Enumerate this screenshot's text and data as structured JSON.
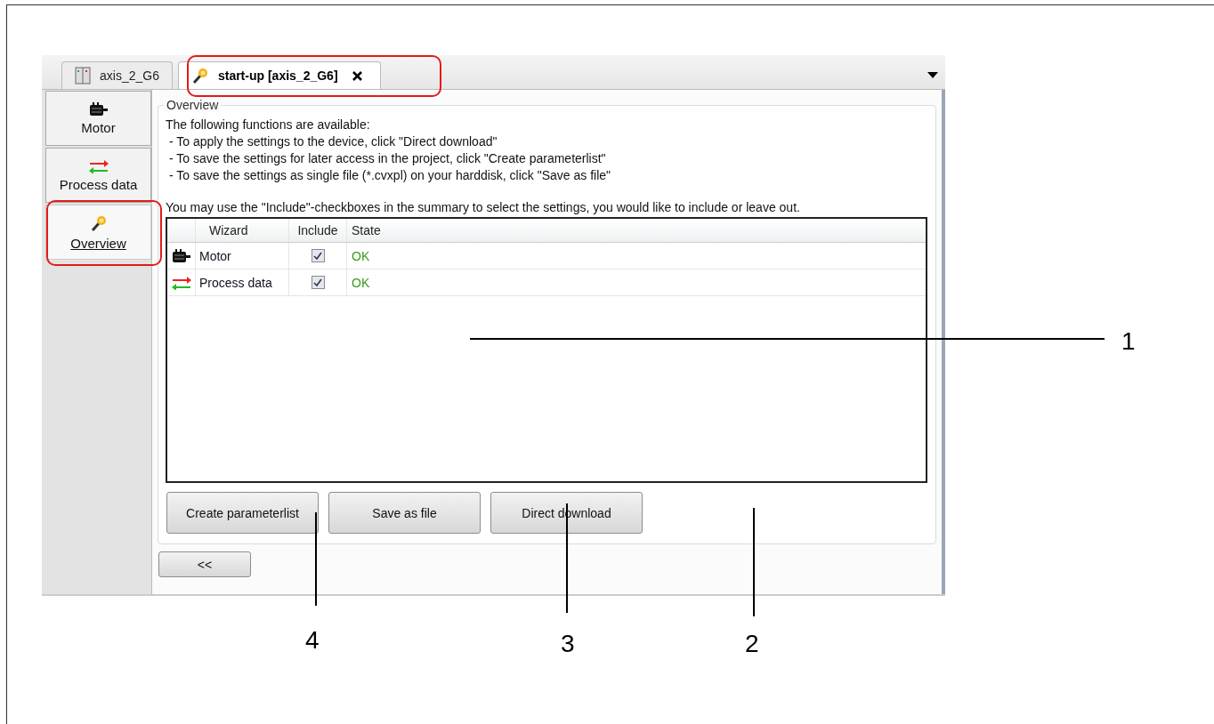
{
  "tabs": [
    {
      "label": "axis_2_G6",
      "kind": "device",
      "selected": false
    },
    {
      "label": "start-up [axis_2_G6]",
      "kind": "wizard",
      "selected": true,
      "closable": true
    }
  ],
  "sidebar": {
    "items": [
      {
        "label": "Motor",
        "kind": "motor",
        "selected": false
      },
      {
        "label": "Process data",
        "kind": "process",
        "selected": false
      },
      {
        "label": "Overview",
        "kind": "wizard",
        "selected": true
      }
    ]
  },
  "overview": {
    "legend": "Overview",
    "intro": "The following functions are available:",
    "bullets": [
      "- To apply the settings to the device, click \"Direct download\"",
      "- To save the settings for later access in the project, click \"Create parameterlist\"",
      "- To save the settings as single file (*.cvxpl) on your harddisk, click \"Save as file\""
    ],
    "note": "You may use the \"Include\"-checkboxes in the summary to select the settings, you would like to include or leave out.",
    "table": {
      "columns": [
        "Wizard",
        "Include",
        "State"
      ],
      "rows": [
        {
          "kind": "motor",
          "wizard": "Motor",
          "include": true,
          "state": "OK"
        },
        {
          "kind": "process",
          "wizard": "Process data",
          "include": true,
          "state": "OK"
        }
      ]
    },
    "buttons": [
      "Create parameterlist",
      "Save as file",
      "Direct download"
    ]
  },
  "back_button": "<<",
  "callouts": [
    {
      "label": "1"
    },
    {
      "label": "4"
    },
    {
      "label": "3"
    },
    {
      "label": "2"
    }
  ]
}
